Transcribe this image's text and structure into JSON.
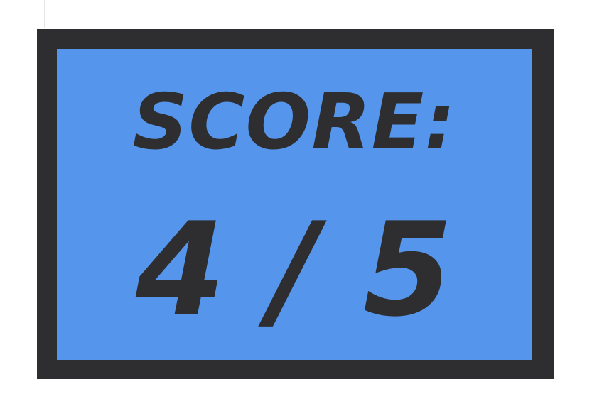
{
  "score": {
    "label": "SCORE:",
    "value_text": "4 / 5",
    "earned": 4,
    "total": 5
  },
  "colors": {
    "frame": "#2e2e30",
    "panel": "#5596ec",
    "text": "#2e2e30",
    "background": "#ffffff"
  }
}
